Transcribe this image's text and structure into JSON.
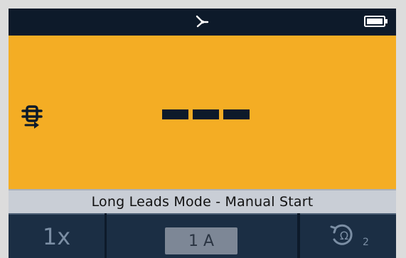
{
  "status": {
    "signal_icon": "antenna-icon",
    "battery_icon": "battery-icon"
  },
  "display": {
    "mode_icon": "long-leads-icon",
    "reading": "---",
    "background_color": "#f4ad24"
  },
  "mode_bar": {
    "text": "Long Leads Mode - Manual Start"
  },
  "softkeys": [
    {
      "label": "1x"
    },
    {
      "label": "1 A"
    },
    {
      "label": "",
      "icon": "ohm-zero-icon",
      "subscript": "2"
    }
  ]
}
